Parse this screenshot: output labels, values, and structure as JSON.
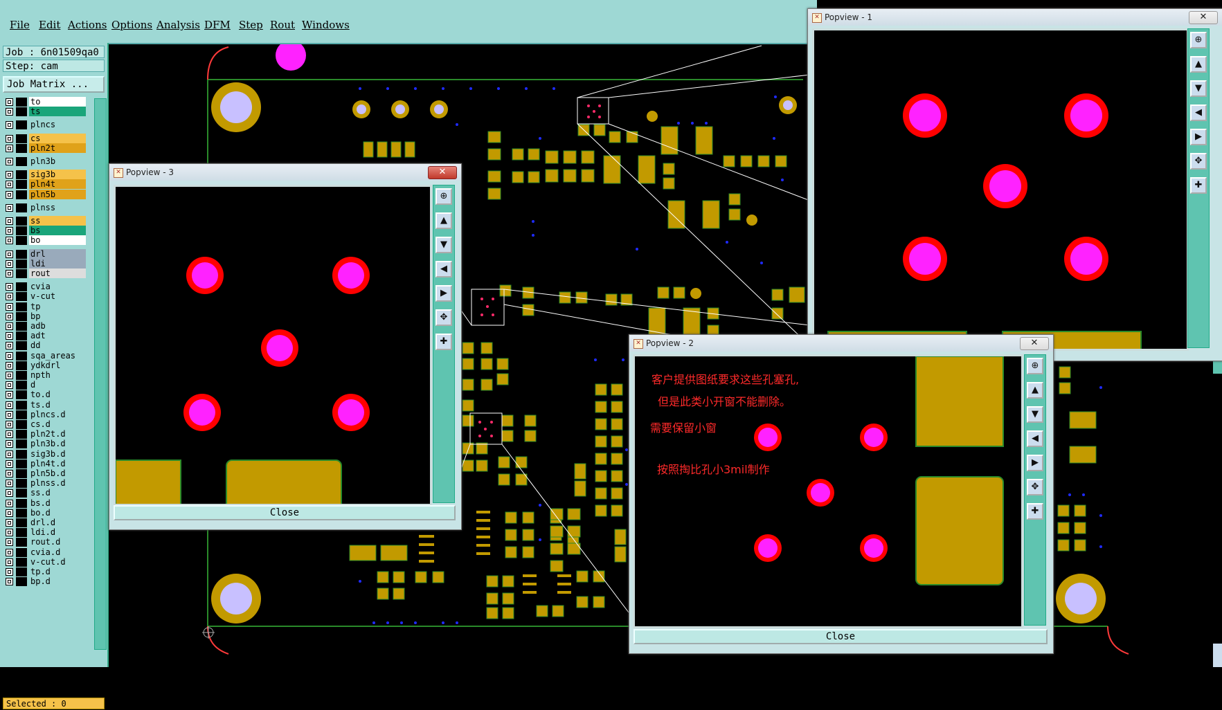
{
  "menu": [
    "File",
    "Edit",
    "Actions",
    "Options",
    "Analysis",
    "DFM",
    "Step",
    "Rout",
    "Windows"
  ],
  "job": {
    "job_line": "Job : 6n01509qa0",
    "step_line": "Step: cam",
    "job_matrix": "Job Matrix ..."
  },
  "layers": [
    {
      "name": "to",
      "color": "#ffffff"
    },
    {
      "name": "ts",
      "color": "#1aa57a"
    },
    {
      "name": "plncs",
      "color": "#9ed8d4"
    },
    {
      "name": "cs",
      "color": "#f5c24a"
    },
    {
      "name": "pln2t",
      "color": "#e0a21a"
    },
    {
      "name": "pln3b",
      "color": "#9ed8d4"
    },
    {
      "name": "sig3b",
      "color": "#f5c24a"
    },
    {
      "name": "pln4t",
      "color": "#e0a21a"
    },
    {
      "name": "pln5b",
      "color": "#e0a21a"
    },
    {
      "name": "plnss",
      "color": "#9ed8d4"
    },
    {
      "name": "ss",
      "color": "#f5c24a"
    },
    {
      "name": "bs",
      "color": "#1aa57a"
    },
    {
      "name": "bo",
      "color": "#ffffff"
    },
    {
      "name": "drl",
      "color": "#9ab"
    },
    {
      "name": "ldi",
      "color": "#9ab"
    },
    {
      "name": "rout",
      "color": "#ddd"
    },
    {
      "name": "cvia",
      "color": "#9ed8d4"
    },
    {
      "name": "v-cut",
      "color": "#9ed8d4"
    },
    {
      "name": "tp",
      "color": "#9ed8d4"
    },
    {
      "name": "bp",
      "color": "#9ed8d4"
    },
    {
      "name": "adb",
      "color": "#9ed8d4"
    },
    {
      "name": "adt",
      "color": "#9ed8d4"
    },
    {
      "name": "dd",
      "color": "#9ed8d4"
    },
    {
      "name": "sqa_areas",
      "color": "#9ed8d4"
    },
    {
      "name": "ydkdrl",
      "color": "#9ed8d4"
    },
    {
      "name": "npth",
      "color": "#9ed8d4"
    },
    {
      "name": "d",
      "color": "#9ed8d4"
    },
    {
      "name": "to.d",
      "color": "#9ed8d4"
    },
    {
      "name": "ts.d",
      "color": "#9ed8d4"
    },
    {
      "name": "plncs.d",
      "color": "#9ed8d4"
    },
    {
      "name": "cs.d",
      "color": "#9ed8d4"
    },
    {
      "name": "pln2t.d",
      "color": "#9ed8d4"
    },
    {
      "name": "pln3b.d",
      "color": "#9ed8d4"
    },
    {
      "name": "sig3b.d",
      "color": "#9ed8d4"
    },
    {
      "name": "pln4t.d",
      "color": "#9ed8d4"
    },
    {
      "name": "pln5b.d",
      "color": "#9ed8d4"
    },
    {
      "name": "plnss.d",
      "color": "#9ed8d4"
    },
    {
      "name": "ss.d",
      "color": "#9ed8d4"
    },
    {
      "name": "bs.d",
      "color": "#9ed8d4"
    },
    {
      "name": "bo.d",
      "color": "#9ed8d4"
    },
    {
      "name": "drl.d",
      "color": "#9ed8d4"
    },
    {
      "name": "ldi.d",
      "color": "#9ed8d4"
    },
    {
      "name": "rout.d",
      "color": "#9ed8d4"
    },
    {
      "name": "cvia.d",
      "color": "#9ed8d4"
    },
    {
      "name": "v-cut.d",
      "color": "#9ed8d4"
    },
    {
      "name": "tp.d",
      "color": "#9ed8d4"
    },
    {
      "name": "bp.d",
      "color": "#9ed8d4"
    }
  ],
  "selected": "Selected : 0",
  "pop1": {
    "title": "Popview - 1"
  },
  "pop2": {
    "title": "Popview - 2",
    "close": "Close",
    "notes": [
      "客户提供图纸要求这些孔塞孔,",
      "但是此类小开窗不能删除。",
      "需要保留小窗",
      "按照掏比孔小3mil制作"
    ]
  },
  "pop3": {
    "title": "Popview - 3",
    "close": "Close"
  },
  "toolbar_icons": [
    "zoom-in-icon",
    "zoom-up-icon",
    "zoom-down-icon",
    "pan-left-icon",
    "pan-right-icon",
    "fit-screen-icon",
    "center-icon"
  ],
  "colors": {
    "pad": "#c29a00",
    "pad_outline": "#2a8a2a",
    "hole_ring": "#ff0000",
    "hole": "#ff22ff",
    "via": "#1f2aff",
    "board": "#000000"
  }
}
